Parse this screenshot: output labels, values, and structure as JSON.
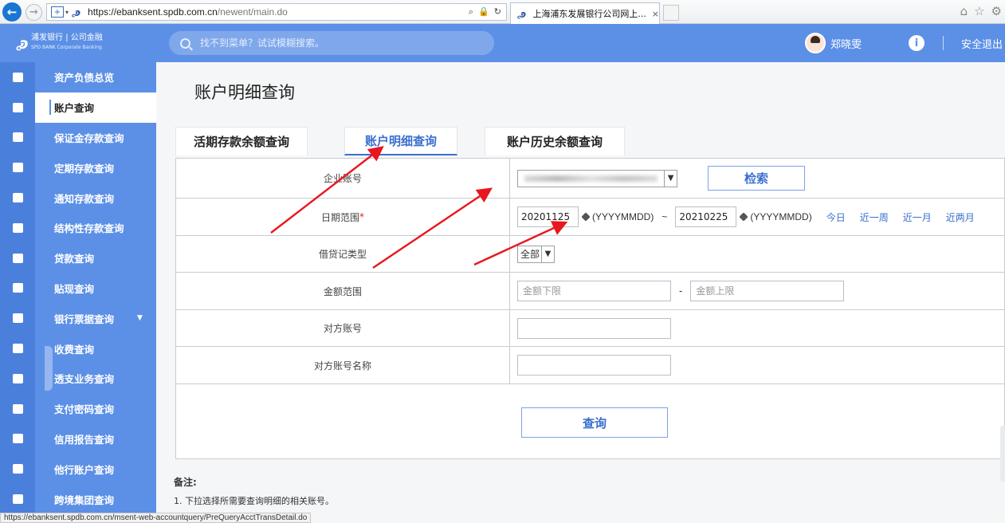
{
  "browser": {
    "url_host": "https://ebanksent.spdb.com.cn",
    "url_path": "/newent/main.do",
    "tab_title": "上海浦东发展银行公司网上...",
    "status_url": "https://ebanksent.spdb.com.cn/msent-web-accountquery/PreQueryAcctTransDetail.do"
  },
  "header": {
    "logo_cn": "浦发银行 | 公司金融",
    "logo_en": "SPD BANK   Corporate Banking",
    "search_placeholder": "找不到菜单？试试模糊搜索。",
    "user_name": "郑晓雯",
    "logout": "安全退出"
  },
  "sidebar": {
    "items": [
      {
        "label": "资产负债总览"
      },
      {
        "label": "账户查询"
      },
      {
        "label": "保证金存款查询"
      },
      {
        "label": "定期存款查询"
      },
      {
        "label": "通知存款查询"
      },
      {
        "label": "结构性存款查询"
      },
      {
        "label": "贷款查询"
      },
      {
        "label": "贴现查询"
      },
      {
        "label": "银行票据查询"
      },
      {
        "label": "收费查询"
      },
      {
        "label": "透支业务查询"
      },
      {
        "label": "支付密码查询"
      },
      {
        "label": "信用报告查询"
      },
      {
        "label": "他行账户查询"
      },
      {
        "label": "跨境集团查询"
      }
    ]
  },
  "main": {
    "title": "账户明细查询",
    "tabs": [
      "活期存款余额查询",
      "账户明细查询",
      "账户历史余额查询"
    ],
    "form": {
      "account_label": "企业账号",
      "search_btn": "检索",
      "date_label": "日期范围",
      "required_mark": "*",
      "date_start": "20201125",
      "date_end": "20210225",
      "date_format": "(YYYYMMDD)",
      "date_sep": "~",
      "quick": [
        "今日",
        "近一周",
        "近一月",
        "近两月"
      ],
      "dc_label": "借贷记类型",
      "dc_value": "全部",
      "amount_label": "金额范围",
      "amount_min_placeholder": "金额下限",
      "amount_max_placeholder": "金额上限",
      "amount_sep": "-",
      "counter_acct_label": "对方账号",
      "counter_name_label": "对方账号名称",
      "query_btn": "查询"
    },
    "notes_title": "备注:",
    "notes_text": "1. 下拉选择所需要查询明细的相关账号。"
  }
}
